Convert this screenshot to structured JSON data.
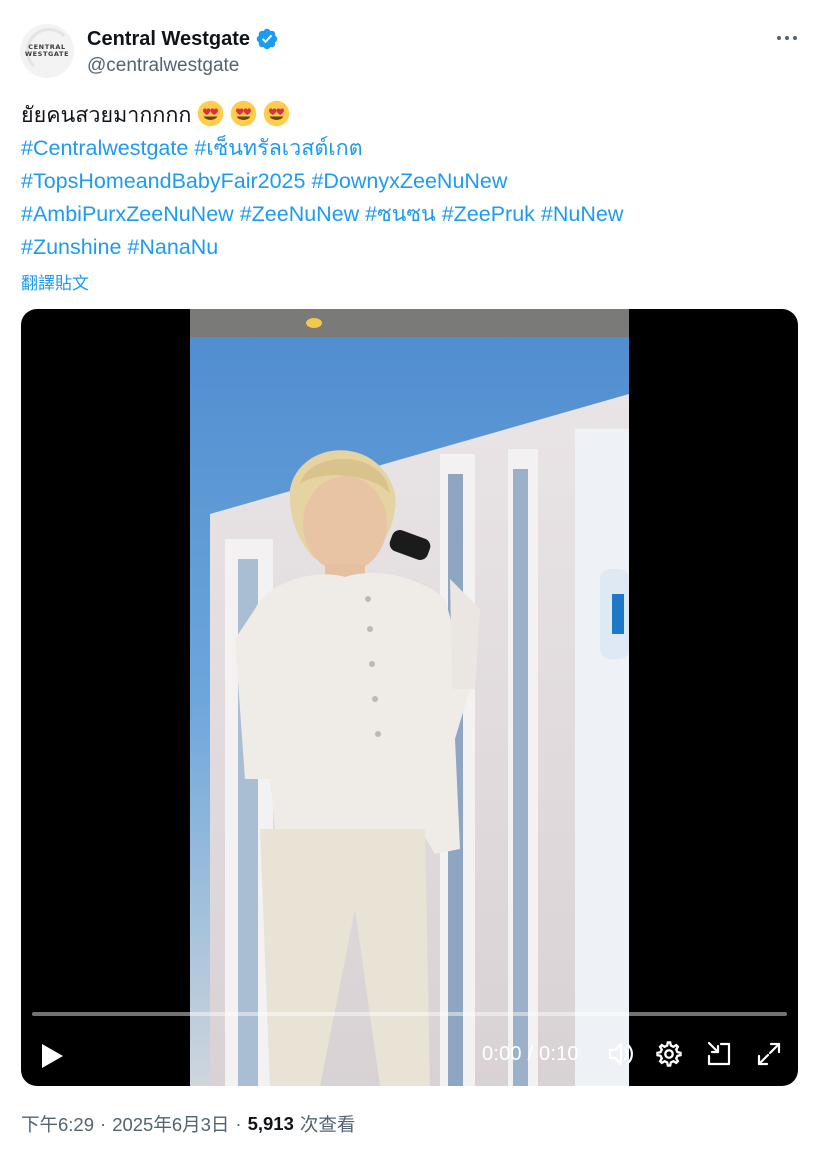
{
  "author": {
    "display_name": "Central Westgate",
    "handle": "@centralwestgate",
    "avatar_logo_line1": "CENTRAL",
    "avatar_logo_line2": "WESTGATE",
    "verified_icon": "verified-badge-icon",
    "verified_color": "#1d9bf0"
  },
  "tweet": {
    "text_plain": "ยัยคนสวยมากกกก",
    "emojis": [
      "heart-eyes-emoji",
      "heart-eyes-emoji",
      "heart-eyes-emoji"
    ],
    "hashtags": {
      "line1": [
        "#Centralwestgate",
        "#เซ็นทรัลเวสต์เกต"
      ],
      "line2": [
        "#TopsHomeandBabyFair2025",
        "#DownyxZeeNuNew"
      ],
      "line3": [
        "#AmbiPurxZeeNuNew",
        "#ZeeNuNew",
        "#ซนซน",
        "#ZeePruk",
        "#NuNew"
      ],
      "line4": [
        "#Zunshine",
        "#NanaNu"
      ]
    },
    "translate_label": "翻譯貼文",
    "link_color": "#1d9bf0"
  },
  "video": {
    "current_time": "0:00",
    "duration": "0:10",
    "time_display": "0:00 / 0:10",
    "progress": 0,
    "controls": [
      "play-icon",
      "volume-icon",
      "settings-icon",
      "pip-icon",
      "fullscreen-icon"
    ]
  },
  "meta": {
    "time": "下午6:29",
    "separator": "·",
    "date": "2025年6月3日",
    "views_count": "5,913",
    "views_label": "次查看"
  }
}
